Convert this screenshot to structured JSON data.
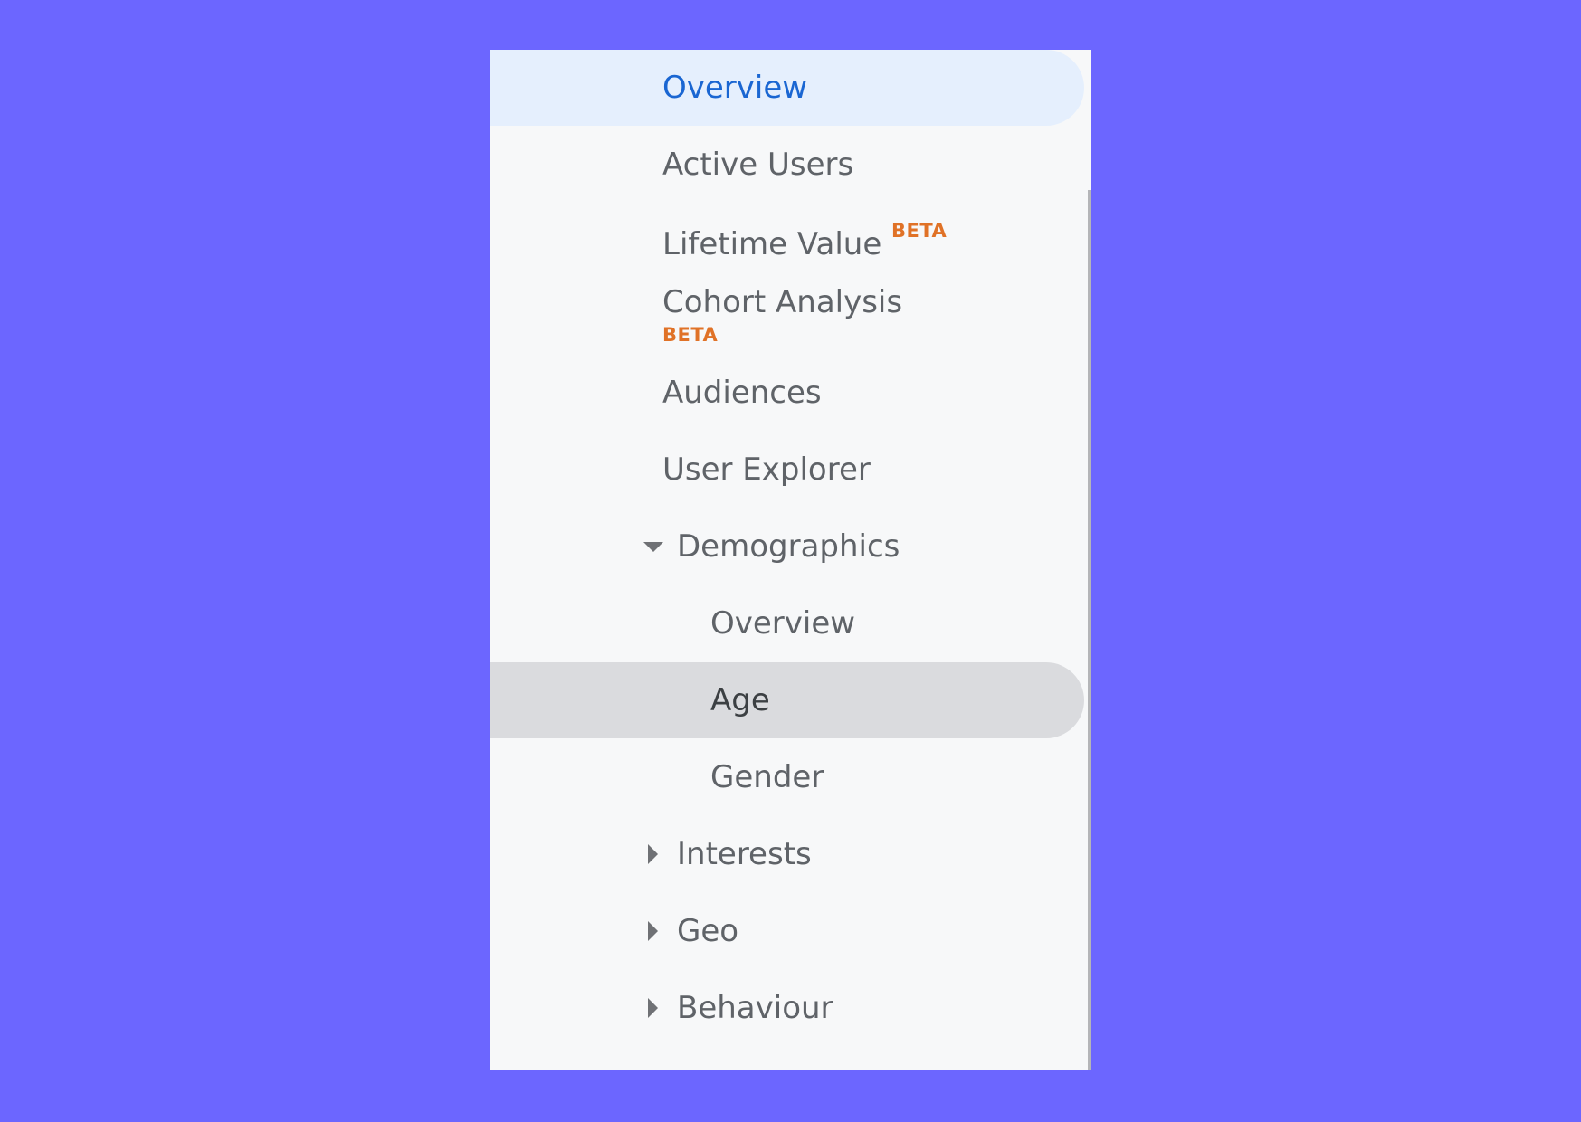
{
  "nav": {
    "items": [
      {
        "label": "Overview",
        "state": "active"
      },
      {
        "label": "Active Users"
      },
      {
        "label": "Lifetime Value",
        "badge": "BETA"
      },
      {
        "label": "Cohort Analysis",
        "badge": "BETA"
      },
      {
        "label": "Audiences"
      },
      {
        "label": "User Explorer"
      },
      {
        "label": "Demographics",
        "expanded": true,
        "icon": "caret-down-icon",
        "children": [
          {
            "label": "Overview"
          },
          {
            "label": "Age",
            "state": "selected"
          },
          {
            "label": "Gender"
          }
        ]
      },
      {
        "label": "Interests",
        "expanded": false,
        "icon": "caret-right-icon"
      },
      {
        "label": "Geo",
        "expanded": false,
        "icon": "caret-right-icon"
      },
      {
        "label": "Behaviour",
        "expanded": false,
        "icon": "caret-right-icon"
      }
    ]
  },
  "colors": {
    "background": "#6c66ff",
    "panel": "#f7f8f9",
    "active_bg": "#e5effd",
    "active_text": "#1a66d2",
    "selected_bg": "#dadbde",
    "text": "#5f6368",
    "beta": "#e07227"
  }
}
